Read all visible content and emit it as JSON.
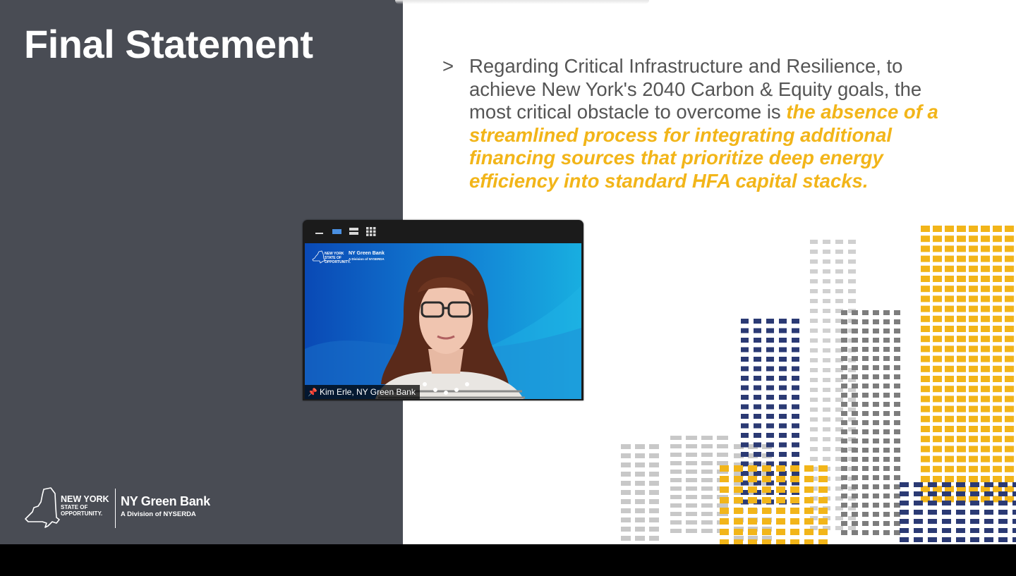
{
  "slide": {
    "title": "Final Statement",
    "bullet_marker": ">",
    "bullet_text_plain": "Regarding Critical Infrastructure and Resilience, to achieve New York's 2040 Carbon & Equity goals, the most critical obstacle to overcome is ",
    "bullet_text_highlight": "the absence of a streamlined process for integrating additional financing sources that prioritize deep energy efficiency into standard HFA capital stacks.",
    "highlight_color": "#f2b519",
    "panel_color": "#494c54"
  },
  "logo": {
    "state_line1": "NEW YORK",
    "state_line2": "STATE OF",
    "state_line3": "OPPORTUNITY.",
    "org_name": "NY Green Bank",
    "org_sub": "A Division of NYSERDA"
  },
  "video": {
    "participant_name": "Kim Erle, NY Green Bank",
    "toolbar_icons": [
      "minimize-icon",
      "speaker-view-icon",
      "gallery-strip-icon",
      "grid-view-icon"
    ],
    "background_logo_state": "NEW YORK STATE OF OPPORTUNITY.",
    "background_logo_org": "NY Green Bank",
    "background_logo_sub": "A Division of NYSERDA"
  }
}
